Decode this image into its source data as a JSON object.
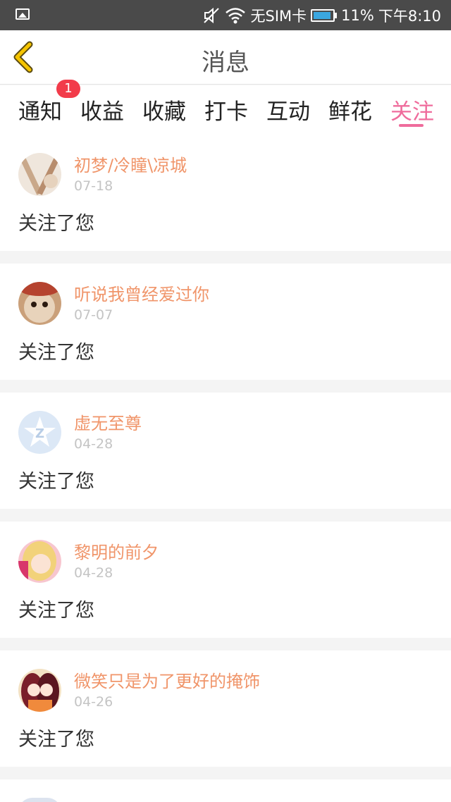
{
  "status_bar": {
    "carrier": "无SIM卡",
    "battery": "11%",
    "time": "下午8:10",
    "icons": [
      "image-icon",
      "mute-icon",
      "wifi-icon",
      "battery-icon"
    ]
  },
  "header": {
    "title": "消息",
    "back_icon": "chevron-left-icon"
  },
  "tabs": [
    {
      "label": "通知",
      "badge": "1"
    },
    {
      "label": "收益"
    },
    {
      "label": "收藏"
    },
    {
      "label": "打卡"
    },
    {
      "label": "互动"
    },
    {
      "label": "鲜花"
    },
    {
      "label": "关注",
      "active": true
    }
  ],
  "items": [
    {
      "name": "初梦/冷瞳\\凉城",
      "date": "07-18",
      "message": "关注了您"
    },
    {
      "name": "听说我曾经爱过你",
      "date": "07-07",
      "message": "关注了您"
    },
    {
      "name": "虚无至尊",
      "date": "04-28",
      "message": "关注了您"
    },
    {
      "name": "黎明的前夕",
      "date": "04-28",
      "message": "关注了您"
    },
    {
      "name": "微笑只是为了更好的掩饰",
      "date": "04-26",
      "message": "关注了您"
    }
  ],
  "colors": {
    "accent": "#ef6c9c",
    "name": "#f0956a",
    "badge": "#f23b4a",
    "back": "#f5c400"
  }
}
